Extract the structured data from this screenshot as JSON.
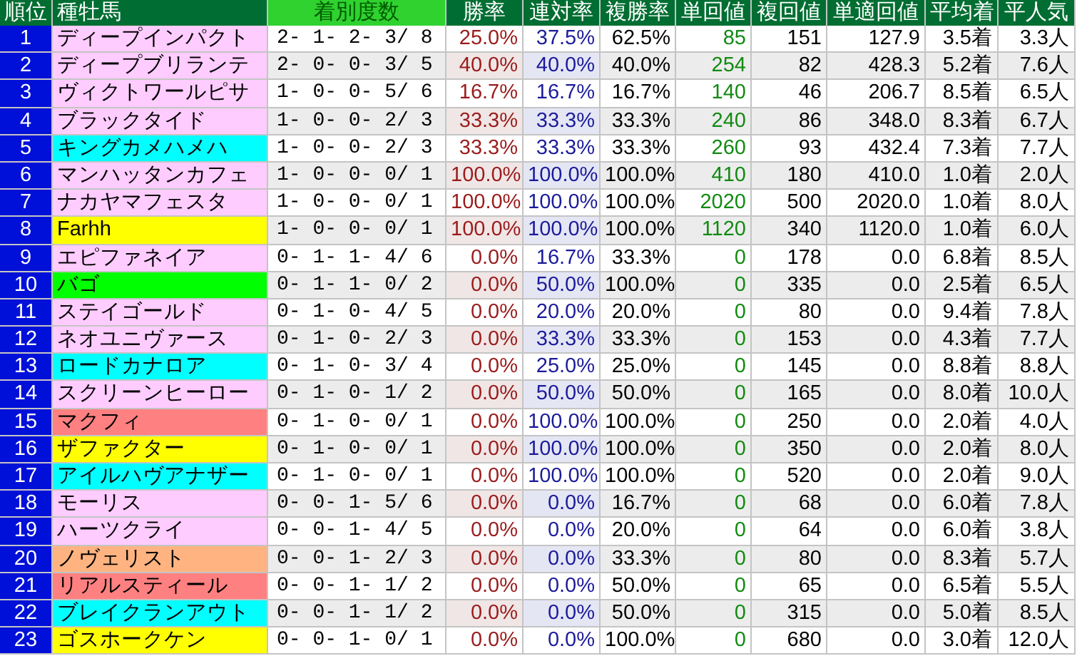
{
  "columns": [
    {
      "label": "順位",
      "highlighted": false
    },
    {
      "label": "種牡馬",
      "highlighted": false
    },
    {
      "label": "着別度数",
      "highlighted": true
    },
    {
      "label": "勝率",
      "highlighted": false
    },
    {
      "label": "連対率",
      "highlighted": false
    },
    {
      "label": "複勝率",
      "highlighted": false
    },
    {
      "label": "単回値",
      "highlighted": false
    },
    {
      "label": "複回値",
      "highlighted": false
    },
    {
      "label": "単適回値",
      "highlighted": false
    },
    {
      "label": "平均着",
      "highlighted": false
    },
    {
      "label": "平人気",
      "highlighted": false
    }
  ],
  "rows": [
    {
      "rank": "1",
      "name": "ディープインパクト",
      "color": "#ffccff",
      "record": "2- 1- 2- 3/ 8",
      "win": "25.0%",
      "top2": "37.5%",
      "top3": "62.5%",
      "win_return": "85",
      "place_return": "151",
      "adj_return": "127.9",
      "avg_finish": "3.5着",
      "avg_pop": "3.3人"
    },
    {
      "rank": "2",
      "name": "ディープブリランテ",
      "color": "#ffccff",
      "record": "2- 0- 0- 3/ 5",
      "win": "40.0%",
      "top2": "40.0%",
      "top3": "40.0%",
      "win_return": "254",
      "place_return": "82",
      "adj_return": "428.3",
      "avg_finish": "5.2着",
      "avg_pop": "7.6人"
    },
    {
      "rank": "3",
      "name": "ヴィクトワールピサ",
      "color": "#ffccff",
      "record": "1- 0- 0- 5/ 6",
      "win": "16.7%",
      "top2": "16.7%",
      "top3": "16.7%",
      "win_return": "140",
      "place_return": "46",
      "adj_return": "206.7",
      "avg_finish": "8.5着",
      "avg_pop": "6.5人"
    },
    {
      "rank": "4",
      "name": "ブラックタイド",
      "color": "#ffccff",
      "record": "1- 0- 0- 2/ 3",
      "win": "33.3%",
      "top2": "33.3%",
      "top3": "33.3%",
      "win_return": "240",
      "place_return": "86",
      "adj_return": "348.0",
      "avg_finish": "8.3着",
      "avg_pop": "6.7人"
    },
    {
      "rank": "5",
      "name": "キングカメハメハ",
      "color": "#00ffff",
      "record": "1- 0- 0- 2/ 3",
      "win": "33.3%",
      "top2": "33.3%",
      "top3": "33.3%",
      "win_return": "260",
      "place_return": "93",
      "adj_return": "432.4",
      "avg_finish": "7.3着",
      "avg_pop": "7.7人"
    },
    {
      "rank": "6",
      "name": "マンハッタンカフェ",
      "color": "#ffccff",
      "record": "1- 0- 0- 0/ 1",
      "win": "100.0%",
      "top2": "100.0%",
      "top3": "100.0%",
      "win_return": "410",
      "place_return": "180",
      "adj_return": "410.0",
      "avg_finish": "1.0着",
      "avg_pop": "2.0人"
    },
    {
      "rank": "7",
      "name": "ナカヤマフェスタ",
      "color": "#ffccff",
      "record": "1- 0- 0- 0/ 1",
      "win": "100.0%",
      "top2": "100.0%",
      "top3": "100.0%",
      "win_return": "2020",
      "place_return": "500",
      "adj_return": "2020.0",
      "avg_finish": "1.0着",
      "avg_pop": "8.0人"
    },
    {
      "rank": "8",
      "name": "Farhh",
      "color": "#ffff00",
      "record": "1- 0- 0- 0/ 1",
      "win": "100.0%",
      "top2": "100.0%",
      "top3": "100.0%",
      "win_return": "1120",
      "place_return": "340",
      "adj_return": "1120.0",
      "avg_finish": "1.0着",
      "avg_pop": "6.0人"
    },
    {
      "rank": "9",
      "name": "エピファネイア",
      "color": "#ffccff",
      "record": "0- 1- 1- 4/ 6",
      "win": "0.0%",
      "top2": "16.7%",
      "top3": "33.3%",
      "win_return": "0",
      "place_return": "178",
      "adj_return": "0.0",
      "avg_finish": "6.8着",
      "avg_pop": "8.5人"
    },
    {
      "rank": "10",
      "name": "バゴ",
      "color": "#00ff00",
      "record": "0- 1- 1- 0/ 2",
      "win": "0.0%",
      "top2": "50.0%",
      "top3": "100.0%",
      "win_return": "0",
      "place_return": "335",
      "adj_return": "0.0",
      "avg_finish": "2.5着",
      "avg_pop": "6.5人"
    },
    {
      "rank": "11",
      "name": "ステイゴールド",
      "color": "#ffccff",
      "record": "0- 1- 0- 4/ 5",
      "win": "0.0%",
      "top2": "20.0%",
      "top3": "20.0%",
      "win_return": "0",
      "place_return": "80",
      "adj_return": "0.0",
      "avg_finish": "9.4着",
      "avg_pop": "7.8人"
    },
    {
      "rank": "12",
      "name": "ネオユニヴァース",
      "color": "#ffccff",
      "record": "0- 1- 0- 2/ 3",
      "win": "0.0%",
      "top2": "33.3%",
      "top3": "33.3%",
      "win_return": "0",
      "place_return": "153",
      "adj_return": "0.0",
      "avg_finish": "4.3着",
      "avg_pop": "7.7人"
    },
    {
      "rank": "13",
      "name": "ロードカナロア",
      "color": "#00ffff",
      "record": "0- 1- 0- 3/ 4",
      "win": "0.0%",
      "top2": "25.0%",
      "top3": "25.0%",
      "win_return": "0",
      "place_return": "145",
      "adj_return": "0.0",
      "avg_finish": "8.8着",
      "avg_pop": "8.8人"
    },
    {
      "rank": "14",
      "name": "スクリーンヒーロー",
      "color": "#ffccff",
      "record": "0- 1- 0- 1/ 2",
      "win": "0.0%",
      "top2": "50.0%",
      "top3": "50.0%",
      "win_return": "0",
      "place_return": "165",
      "adj_return": "0.0",
      "avg_finish": "8.0着",
      "avg_pop": "10.0人"
    },
    {
      "rank": "15",
      "name": "マクフィ",
      "color": "#ff8080",
      "record": "0- 1- 0- 0/ 1",
      "win": "0.0%",
      "top2": "100.0%",
      "top3": "100.0%",
      "win_return": "0",
      "place_return": "250",
      "adj_return": "0.0",
      "avg_finish": "2.0着",
      "avg_pop": "4.0人"
    },
    {
      "rank": "16",
      "name": "ザファクター",
      "color": "#ffff00",
      "record": "0- 1- 0- 0/ 1",
      "win": "0.0%",
      "top2": "100.0%",
      "top3": "100.0%",
      "win_return": "0",
      "place_return": "350",
      "adj_return": "0.0",
      "avg_finish": "2.0着",
      "avg_pop": "8.0人"
    },
    {
      "rank": "17",
      "name": "アイルハヴアナザー",
      "color": "#00ffff",
      "record": "0- 1- 0- 0/ 1",
      "win": "0.0%",
      "top2": "100.0%",
      "top3": "100.0%",
      "win_return": "0",
      "place_return": "520",
      "adj_return": "0.0",
      "avg_finish": "2.0着",
      "avg_pop": "9.0人"
    },
    {
      "rank": "18",
      "name": "モーリス",
      "color": "#ffccff",
      "record": "0- 0- 1- 5/ 6",
      "win": "0.0%",
      "top2": "0.0%",
      "top3": "16.7%",
      "win_return": "0",
      "place_return": "68",
      "adj_return": "0.0",
      "avg_finish": "6.0着",
      "avg_pop": "7.8人"
    },
    {
      "rank": "19",
      "name": "ハーツクライ",
      "color": "#ffccff",
      "record": "0- 0- 1- 4/ 5",
      "win": "0.0%",
      "top2": "0.0%",
      "top3": "20.0%",
      "win_return": "0",
      "place_return": "64",
      "adj_return": "0.0",
      "avg_finish": "6.0着",
      "avg_pop": "3.8人"
    },
    {
      "rank": "20",
      "name": "ノヴェリスト",
      "color": "#ffb380",
      "record": "0- 0- 1- 2/ 3",
      "win": "0.0%",
      "top2": "0.0%",
      "top3": "33.3%",
      "win_return": "0",
      "place_return": "80",
      "adj_return": "0.0",
      "avg_finish": "8.3着",
      "avg_pop": "5.7人"
    },
    {
      "rank": "21",
      "name": "リアルスティール",
      "color": "#ff8080",
      "record": "0- 0- 1- 1/ 2",
      "win": "0.0%",
      "top2": "0.0%",
      "top3": "50.0%",
      "win_return": "0",
      "place_return": "65",
      "adj_return": "0.0",
      "avg_finish": "6.5着",
      "avg_pop": "5.5人"
    },
    {
      "rank": "22",
      "name": "ブレイクランアウト",
      "color": "#00ffff",
      "record": "0- 0- 1- 1/ 2",
      "win": "0.0%",
      "top2": "0.0%",
      "top3": "50.0%",
      "win_return": "0",
      "place_return": "315",
      "adj_return": "0.0",
      "avg_finish": "5.0着",
      "avg_pop": "8.5人"
    },
    {
      "rank": "23",
      "name": "ゴスホークケン",
      "color": "#ffff00",
      "record": "0- 0- 1- 0/ 1",
      "win": "0.0%",
      "top2": "0.0%",
      "top3": "100.0%",
      "win_return": "0",
      "place_return": "680",
      "adj_return": "0.0",
      "avg_finish": "3.0着",
      "avg_pop": "12.0人"
    }
  ]
}
